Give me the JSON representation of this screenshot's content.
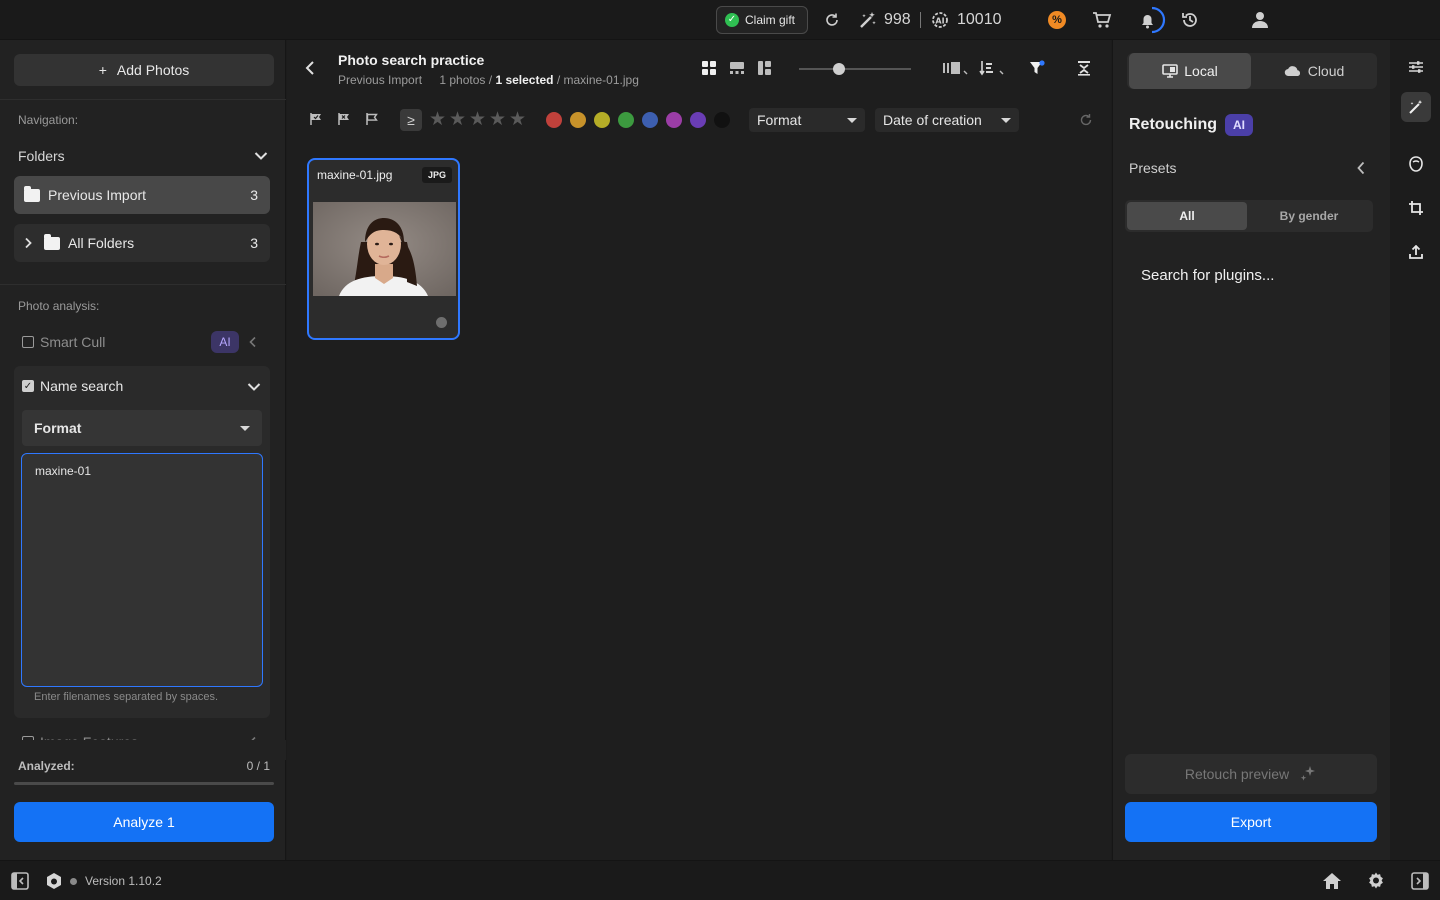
{
  "topbar": {
    "claim_gift": "Claim gift",
    "credits_magic": "998",
    "credits_ai": "10010",
    "colors": {
      "claim_ok": "#2fbf52",
      "promo": "#f08a24"
    }
  },
  "left": {
    "add_photos": "Add Photos",
    "navigation_label": "Navigation:",
    "folders_label": "Folders",
    "folders": [
      {
        "label": "Previous Import",
        "count": "3"
      },
      {
        "label": "All Folders",
        "count": "3"
      }
    ],
    "photo_analysis_label": "Photo analysis:",
    "smart_cull": "Smart Cull",
    "ai_badge": "AI",
    "name_search": "Name search",
    "format_label": "Format",
    "name_input_value": "maxine-01",
    "hint": "Enter filenames separated by spaces.",
    "image_features": "Image Features",
    "analyzed_label": "Analyzed:",
    "analyzed_value": "0 / 1",
    "analyze_button": "Analyze 1"
  },
  "center": {
    "title": "Photo search practice",
    "subtitle_source": "Previous Import",
    "subtitle_count": "1 photos /",
    "subtitle_selected": "1 selected",
    "subtitle_file": "/ maxine-01.jpg",
    "filter": {
      "ge_symbol": "≥",
      "stars": [
        "★",
        "★",
        "★",
        "★",
        "★"
      ],
      "colors": [
        "#c0413b",
        "#c7922a",
        "#b5ad27",
        "#3c9a3f",
        "#3d5fb0",
        "#9b3da6",
        "#6a3db5",
        "#111111"
      ],
      "format_dropdown": "Format",
      "date_dropdown": "Date of creation"
    },
    "photo": {
      "filename": "maxine-01.jpg",
      "badge": "JPG"
    }
  },
  "right": {
    "local": "Local",
    "cloud": "Cloud",
    "retouching": "Retouching",
    "ai_badge": "AI",
    "presets": "Presets",
    "seg_all": "All",
    "seg_gender": "By gender",
    "plugins_placeholder": "Search for plugins...",
    "retouch_preview": "Retouch preview",
    "export": "Export"
  },
  "bottom": {
    "version": "Version 1.10.2"
  }
}
